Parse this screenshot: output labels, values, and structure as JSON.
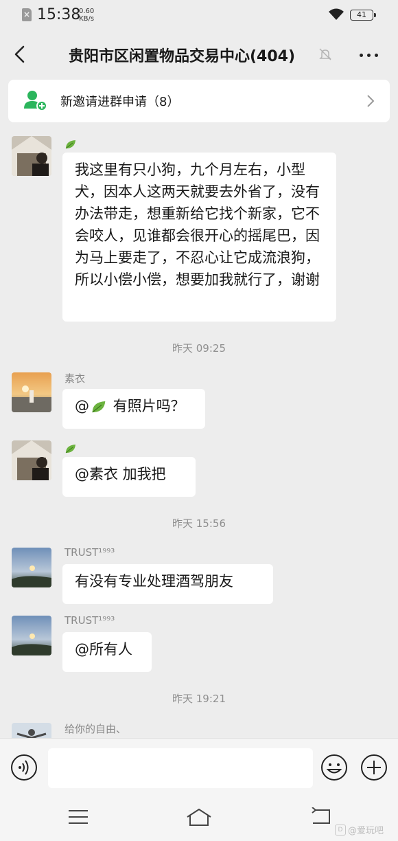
{
  "status_bar": {
    "time": "15:38",
    "speed_value": "0.60",
    "speed_unit": "KB/s",
    "battery": "41",
    "sim_label": "×"
  },
  "header": {
    "title": "贵阳市区闲置物品交易中心(404)"
  },
  "invite_banner": {
    "text": "新邀请进群申请（8）"
  },
  "messages": [
    {
      "sender": "",
      "text": "我这里有只小狗，九个月左右，小型犬，因本人这两天就要去外省了，没有办法带走，想重新给它找个新家，它不会咬人，见谁都会很开心的摇尾巴，因为马上要走了，不忍心让它成流浪狗，所以小偿小偿，想要加我就行了，谢谢"
    },
    {
      "timestamp": "昨天 09:25"
    },
    {
      "sender": "素衣",
      "text_prefix": "@",
      "text": " 有照片吗？"
    },
    {
      "sender": "",
      "text": "@素衣  加我把"
    },
    {
      "timestamp": "昨天 15:56"
    },
    {
      "sender": "TRUST¹⁹⁹³",
      "text": "有没有专业处理酒驾朋友"
    },
    {
      "sender": "TRUST¹⁹⁹³",
      "text": "@所有人"
    },
    {
      "timestamp": "昨天 19:21"
    },
    {
      "sender": "给你的自由、",
      "text": ""
    }
  ],
  "input": {
    "placeholder": ""
  },
  "watermark": {
    "text": "@爱玩吧",
    "box": "D"
  },
  "colors": {
    "background": "#ededed",
    "bubble": "#ffffff",
    "accent_green": "#2bb55c",
    "timestamp": "#8f8f8f"
  }
}
